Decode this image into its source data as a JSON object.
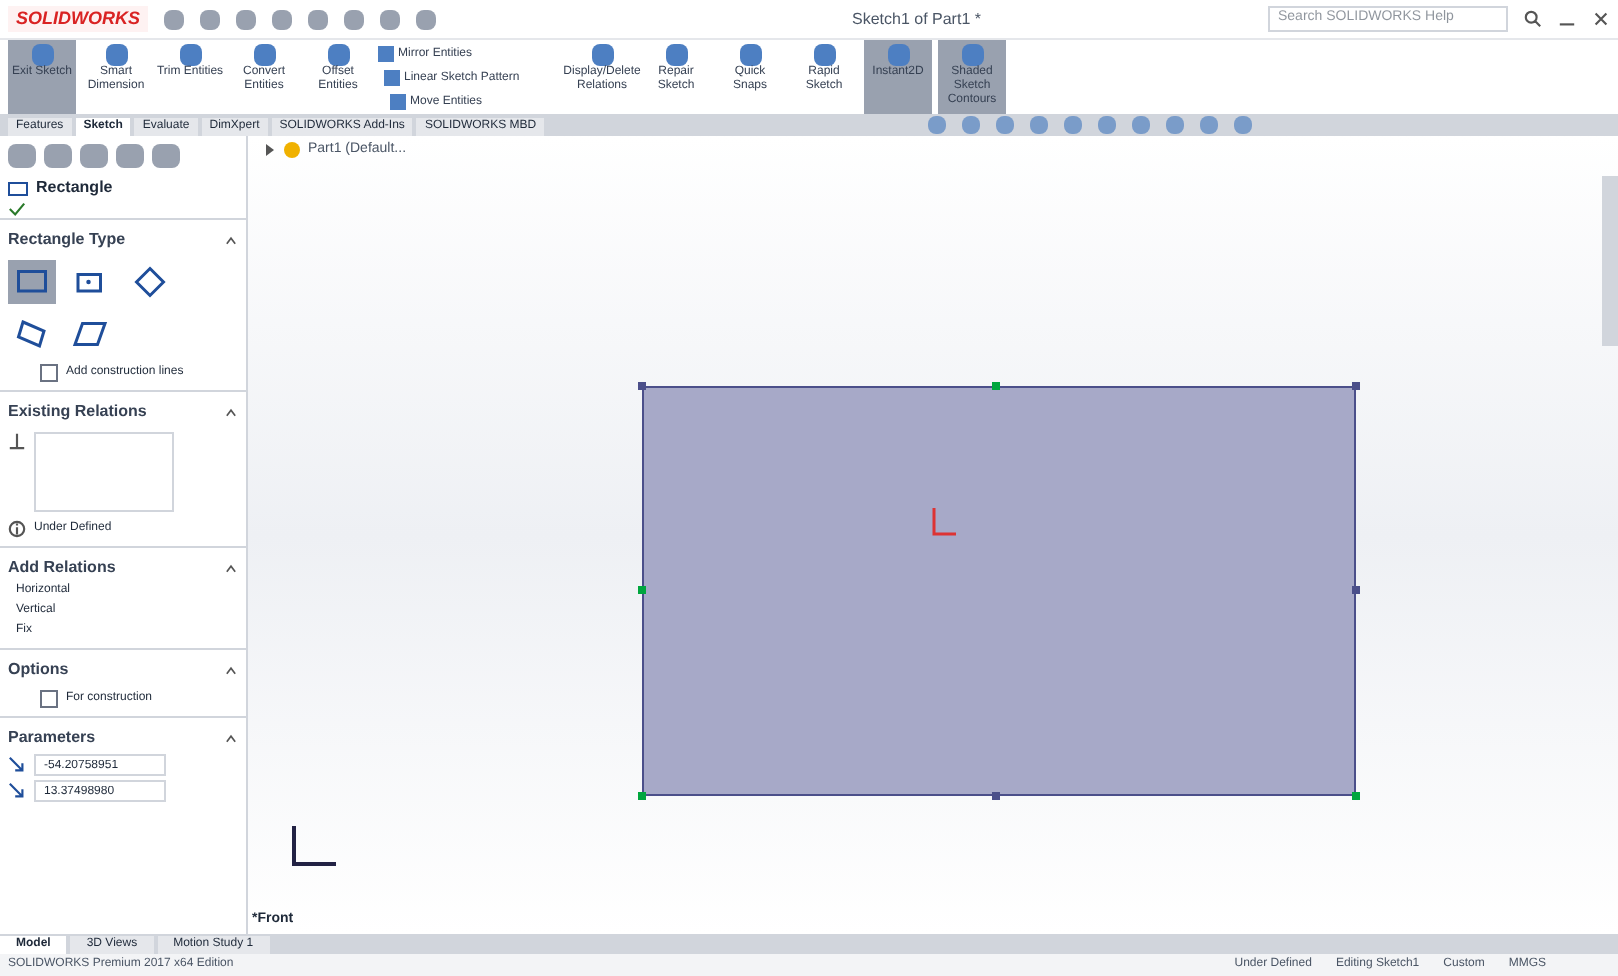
{
  "app": {
    "logo": "SOLIDWORKS",
    "title": "Sketch1 of Part1 *",
    "search": {
      "placeholder": "Search SOLIDWORKS Help"
    }
  },
  "ribbon": [
    {
      "label": "Exit Sketch",
      "selected": true,
      "kind": "big"
    },
    {
      "label": "Smart Dimension",
      "selected": false,
      "kind": "big"
    },
    {
      "label": "Trim Entities",
      "selected": false,
      "kind": "big"
    },
    {
      "label": "Convert Entities",
      "selected": false,
      "kind": "big"
    },
    {
      "label": "Offset Entities",
      "selected": false,
      "kind": "big"
    },
    {
      "label": "Mirror Entities",
      "selected": false,
      "kind": "small"
    },
    {
      "label": "Linear Sketch Pattern",
      "selected": false,
      "kind": "small"
    },
    {
      "label": "Move Entities",
      "selected": false,
      "kind": "small"
    },
    {
      "label": "Display/Delete Relations",
      "selected": false,
      "kind": "big"
    },
    {
      "label": "Repair Sketch",
      "selected": false,
      "kind": "big"
    },
    {
      "label": "Quick Snaps",
      "selected": false,
      "kind": "big"
    },
    {
      "label": "Rapid Sketch",
      "selected": false,
      "kind": "big"
    },
    {
      "label": "Instant2D",
      "selected": true,
      "kind": "big"
    },
    {
      "label": "Shaded Sketch Contours",
      "selected": true,
      "kind": "big"
    }
  ],
  "tabs": [
    {
      "label": "Features",
      "selected": false
    },
    {
      "label": "Sketch",
      "selected": true
    },
    {
      "label": "Evaluate",
      "selected": false
    },
    {
      "label": "DimXpert",
      "selected": false
    },
    {
      "label": "SOLIDWORKS Add-Ins",
      "selected": false
    },
    {
      "label": "SOLIDWORKS MBD",
      "selected": false
    }
  ],
  "tree": {
    "label": "Part1 (Default..."
  },
  "property_manager": {
    "title": "Rectangle",
    "rectangle_type": {
      "title": "Rectangle Type",
      "types": [
        {
          "selected": true
        },
        {
          "selected": false
        },
        {
          "selected": false
        },
        {
          "selected": false
        },
        {
          "selected": false
        }
      ],
      "construction": {
        "label": "Add construction lines",
        "checked": false
      }
    },
    "existing_relations": {
      "title": "Existing Relations",
      "status": "Under Defined"
    },
    "add_relations": {
      "title": "Add Relations",
      "items": [
        "Horizontal",
        "Vertical",
        "Fix"
      ]
    },
    "options": {
      "title": "Options",
      "construction": {
        "label": "For construction",
        "checked": false
      }
    },
    "parameters": {
      "title": "Parameters",
      "values": [
        "-54.20758951",
        "13.37498980"
      ]
    }
  },
  "viewport": {
    "view": "*Front"
  },
  "bottom_tabs": [
    {
      "label": "Model",
      "selected": true
    },
    {
      "label": "3D Views",
      "selected": false
    },
    {
      "label": "Motion Study 1",
      "selected": false
    }
  ],
  "status_bar": {
    "edition": "SOLIDWORKS Premium 2017 x64 Edition",
    "state": "Under Defined",
    "editing": "Editing Sketch1",
    "custom": "Custom",
    "units": "MMGS"
  }
}
